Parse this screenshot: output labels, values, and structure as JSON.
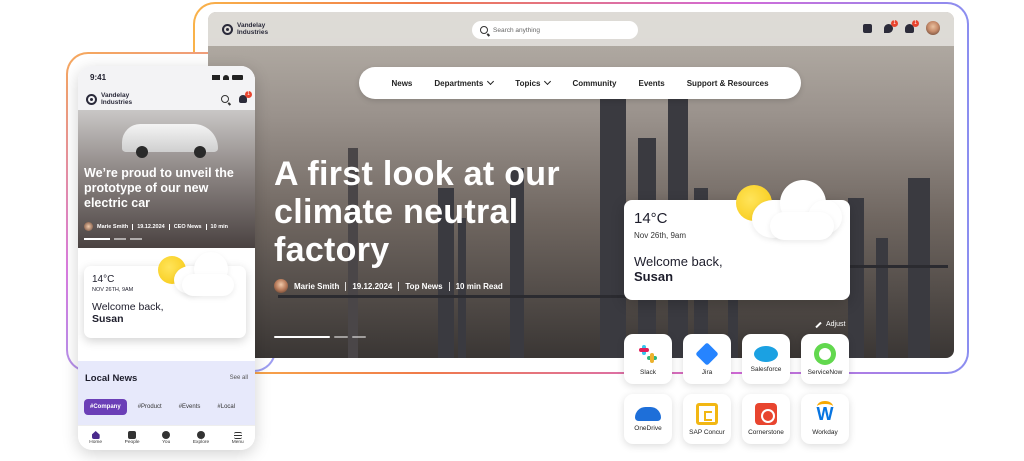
{
  "brand": {
    "name": "Vandelay Industries"
  },
  "desktop": {
    "search": {
      "placeholder": "Search anything"
    },
    "notifications": {
      "chat_count": "1",
      "bell_count": "1"
    },
    "nav": [
      {
        "label": "News"
      },
      {
        "label": "Departments"
      },
      {
        "label": "Topics"
      },
      {
        "label": "Community"
      },
      {
        "label": "Events"
      },
      {
        "label": "Support & Resources"
      }
    ],
    "hero": {
      "title": "A first look at our climate neutral factory",
      "author": "Marie Smith",
      "date": "19.12.2024",
      "category": "Top News",
      "read_time": "10 min Read"
    },
    "weather": {
      "temp": "14°C",
      "date": "Nov 26th, 9am",
      "welcome": "Welcome back,",
      "name": "Susan"
    },
    "adjust_label": "Adjust",
    "apps": [
      {
        "label": "Slack",
        "icon": "slack-icon"
      },
      {
        "label": "Jira",
        "icon": "jira-icon"
      },
      {
        "label": "Salesforce",
        "icon": "salesforce-icon"
      },
      {
        "label": "ServiceNow",
        "icon": "servicenow-icon"
      },
      {
        "label": "OneDrive",
        "icon": "onedrive-icon"
      },
      {
        "label": "SAP Concur",
        "icon": "sap-concur-icon"
      },
      {
        "label": "Cornerstone",
        "icon": "cornerstone-icon"
      },
      {
        "label": "Workday",
        "icon": "workday-icon"
      }
    ]
  },
  "mobile": {
    "time": "9:41",
    "notification_count": "1",
    "hero": {
      "title": "We’re proud to unveil the prototype of our new electric car",
      "author": "Marie Smith",
      "date": "19.12.2024",
      "category": "CEO News",
      "read_time": "10 min"
    },
    "weather": {
      "temp": "14°C",
      "date": "NOV 26TH, 9AM",
      "welcome": "Welcome back,",
      "name": "Susan"
    },
    "local_news": {
      "title": "Local News",
      "see_all": "See all",
      "tags": [
        "#Company",
        "#Product",
        "#Events",
        "#Local"
      ]
    },
    "tabs": [
      {
        "label": "Home"
      },
      {
        "label": "People"
      },
      {
        "label": "You"
      },
      {
        "label": "Explore"
      },
      {
        "label": "Menu"
      }
    ]
  },
  "colors": {
    "accent": "#6b3fb7",
    "badge": "#e8452f",
    "sun": "#f7c80f"
  }
}
